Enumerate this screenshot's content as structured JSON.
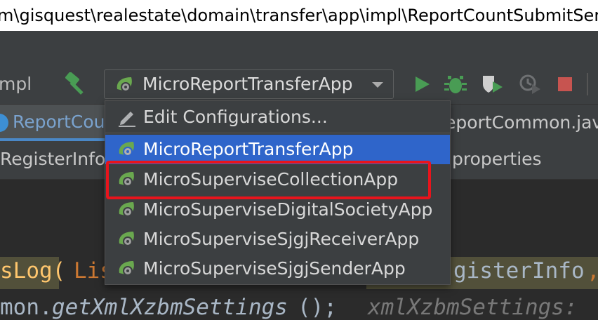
{
  "title_bar": {
    "path": "m\\gisquest\\realestate\\domain\\transfer\\app\\impl\\ReportCountSubmitServic"
  },
  "toolbar": {
    "breadcrumb": "mpl",
    "run_config": "MicroReportTransferApp"
  },
  "tabs": {
    "row1": [
      "ReportCou",
      "eportCommon.jav"
    ],
    "row2": [
      "RegisterInfo",
      "properties"
    ]
  },
  "dropdown": {
    "edit_label": "Edit Configurations...",
    "items": [
      "MicroReportTransferApp",
      "MicroSuperviseCollectionApp",
      "MicroSuperviseDigitalSocietyApp",
      "MicroSuperviseSjgjReceiverApp",
      "MicroSuperviseSjgjSenderApp"
    ],
    "selected_index": 0,
    "highlighted_index": 1
  },
  "code": {
    "line1_a": "sLog(",
    "line1_b": "Lis",
    "line1_c": "gisterInfo",
    "line1_d": ",",
    "line2_a": "mon.",
    "line2_b": "getXmlXzbmSettings",
    "line2_c": "();",
    "line2_d": "xmlXzbmSettings:"
  },
  "colors": {
    "accent_selected": "#2f65ca",
    "highlight_border": "#e8141c",
    "run_green": "#499c54"
  }
}
